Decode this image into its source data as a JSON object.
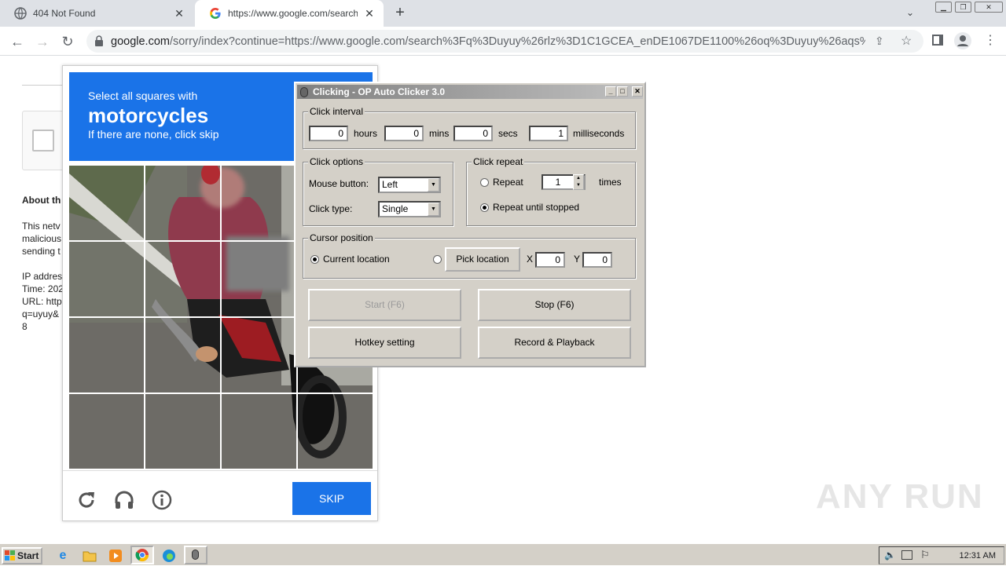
{
  "browser": {
    "tabs": [
      {
        "title": "404 Not Found"
      },
      {
        "title": "https://www.google.com/search?q="
      }
    ],
    "url_domain": "google.com",
    "url_rest": "/sorry/index?continue=https://www.google.com/search%3Fq%3Duyuy%26rlz%3D1C1GCEA_enDE1067DE1100%26oq%3Duyuy%26aqs%..."
  },
  "page": {
    "about_heading": "About th",
    "lines": [
      "This netv",
      "malicious",
      "sending t",
      "",
      "IP addres",
      "Time: 202",
      "URL: http",
      "q=uyuy&",
      "8"
    ]
  },
  "captcha": {
    "line1": "Select all squares with",
    "keyword": "motorcycles",
    "line3": "If there are none, click skip",
    "skip_label": "SKIP"
  },
  "autoclicker": {
    "title": "Clicking - OP Auto Clicker 3.0",
    "interval_group": "Click interval",
    "hours_value": "0",
    "hours_label": "hours",
    "mins_value": "0",
    "mins_label": "mins",
    "secs_value": "0",
    "secs_label": "secs",
    "ms_value": "1",
    "ms_label": "milliseconds",
    "options_group": "Click options",
    "mouse_button_label": "Mouse button:",
    "mouse_button_value": "Left",
    "click_type_label": "Click type:",
    "click_type_value": "Single",
    "repeat_group": "Click repeat",
    "repeat_label": "Repeat",
    "repeat_value": "1",
    "times_label": "times",
    "repeat_until_label": "Repeat until stopped",
    "cursor_group": "Cursor position",
    "current_location_label": "Current location",
    "pick_location_label": "Pick location",
    "x_label": "X",
    "x_value": "0",
    "y_label": "Y",
    "y_value": "0",
    "start_label": "Start (F6)",
    "stop_label": "Stop (F6)",
    "hotkey_label": "Hotkey setting",
    "record_label": "Record & Playback"
  },
  "taskbar": {
    "start_label": "Start",
    "clock": "12:31 AM"
  },
  "watermark": "ANY RUN"
}
